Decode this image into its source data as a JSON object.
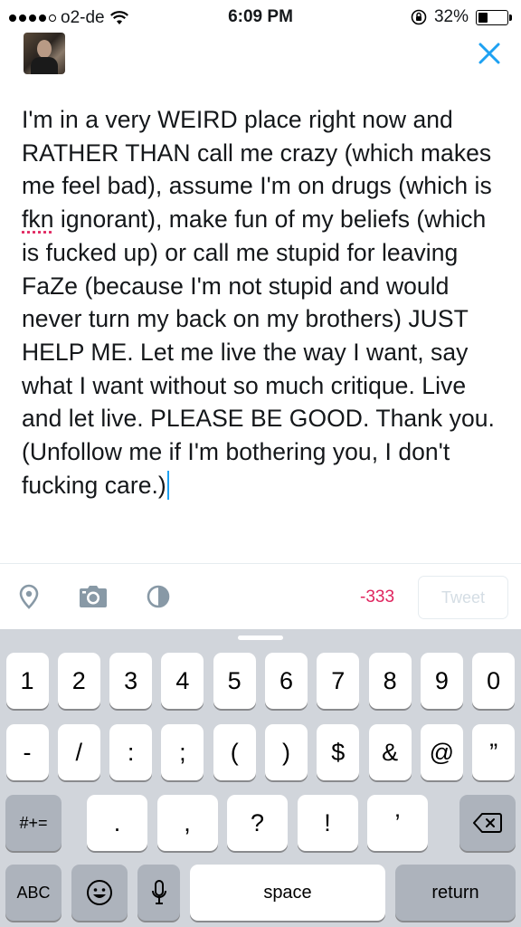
{
  "status_bar": {
    "carrier": "o2-de",
    "time": "6:09 PM",
    "battery_percent": "32%",
    "battery_level": 0.32
  },
  "compose": {
    "text": "I'm in a very WEIRD place right now and RATHER THAN call me crazy (which makes me feel bad), assume I'm on drugs (which is fkn ignorant), make fun of my beliefs (which is fucked up) or call me stupid for leaving FaZe (because I'm not stupid and would never turn my back on my brothers) JUST HELP ME. Let me live the way I want, say what I want without so much critique. Live and let live. PLEASE BE GOOD. Thank you. (Unfollow me if I'm bothering you, I don't fucking care.)",
    "misspelled_word": "fkn"
  },
  "toolbar": {
    "char_count": "-333",
    "tweet_label": "Tweet",
    "icons": [
      "location-pin-icon",
      "camera-icon",
      "poll-icon"
    ]
  },
  "keyboard": {
    "row1": [
      "1",
      "2",
      "3",
      "4",
      "5",
      "6",
      "7",
      "8",
      "9",
      "0"
    ],
    "row2": [
      "-",
      "/",
      ":",
      ";",
      "(",
      ")",
      "$",
      "&",
      "@",
      "”"
    ],
    "row3": {
      "toggle": "#+=",
      "keys": [
        ".",
        ",",
        "?",
        "!",
        "’"
      ]
    },
    "row4": {
      "abc": "ABC",
      "space": "space",
      "return": "return"
    }
  },
  "colors": {
    "accent": "#1da1f2",
    "count_negative": "#e0245e",
    "keyboard_bg": "#d1d5db",
    "dark_key": "#adb3bc"
  }
}
